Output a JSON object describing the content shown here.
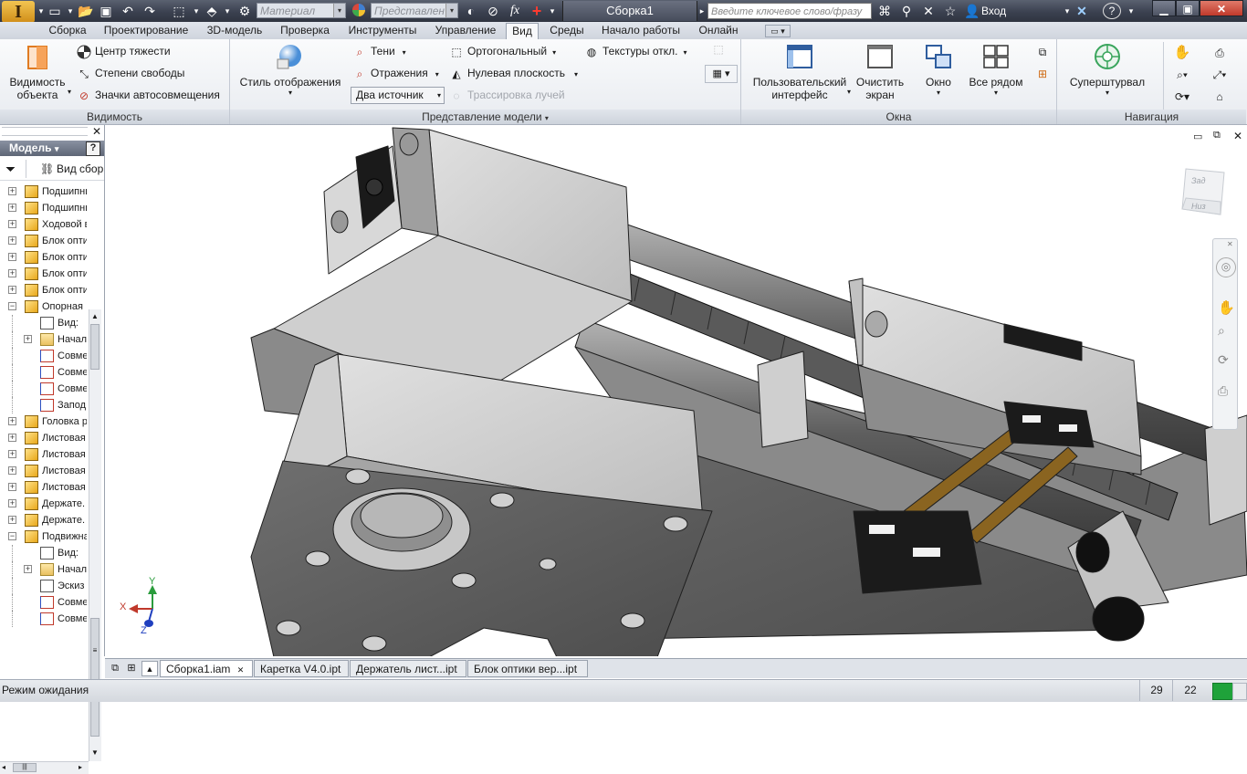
{
  "app": {
    "logo_letter": "I",
    "doc_title": "Сборка1",
    "material_placeholder": "Материал",
    "appearance_placeholder": "Представлен",
    "help_search_placeholder": "Введите ключевое слово/фразу",
    "login_label": "Вход",
    "help_label": "?",
    "qat_icons": [
      "new-icon",
      "open-icon",
      "save-icon",
      "undo-icon",
      "redo-icon",
      "return-icon",
      "select-icon",
      "update-icon"
    ]
  },
  "tabs": [
    {
      "label": "Сборка"
    },
    {
      "label": "Проектирование"
    },
    {
      "label": "3D-модель"
    },
    {
      "label": "Проверка"
    },
    {
      "label": "Инструменты"
    },
    {
      "label": "Управление"
    },
    {
      "label": "Вид",
      "active": true
    },
    {
      "label": "Среды"
    },
    {
      "label": "Начало работы"
    },
    {
      "label": "Онлайн"
    }
  ],
  "ribbon": {
    "visibility": {
      "label": "Видимость",
      "object_visibility": [
        "Видимость",
        "объекта"
      ],
      "items": [
        "Центр тяжести",
        "Степени свободы",
        "Значки автосовмещения"
      ]
    },
    "model_view": {
      "label": "Представление модели",
      "display_style": "Стиль отображения",
      "shadows": "Тени",
      "reflections": "Отражения",
      "lighting": "Два источник",
      "orthographic": "Ортогональный",
      "ground_plane": "Нулевая плоскость",
      "ray_tracing": "Трассировка лучей",
      "textures": "Текстуры откл."
    },
    "windows": {
      "label": "Окна",
      "user_interface": [
        "Пользовательский",
        "интерфейс"
      ],
      "clean_screen": [
        "Очистить",
        "экран"
      ],
      "window": "Окно",
      "tile": "Все рядом"
    },
    "navigation": {
      "label": "Навигация",
      "steering_wheel": "Суперштурвал"
    }
  },
  "browser": {
    "title": "Модель",
    "view_label": "Вид сбор",
    "tree": [
      {
        "label": "Подшипни",
        "icon": "box",
        "level": 0,
        "exp": "+"
      },
      {
        "label": "Подшипни",
        "icon": "box",
        "level": 0,
        "exp": "+"
      },
      {
        "label": "Ходовой в",
        "icon": "box",
        "level": 0,
        "exp": "+"
      },
      {
        "label": "Блок опти",
        "icon": "box",
        "level": 0,
        "exp": "+"
      },
      {
        "label": "Блок опти",
        "icon": "box",
        "level": 0,
        "exp": "+"
      },
      {
        "label": "Блок опти",
        "icon": "box",
        "level": 0,
        "exp": "+"
      },
      {
        "label": "Блок опти",
        "icon": "box",
        "level": 0,
        "exp": "+"
      },
      {
        "label": "Опорная",
        "icon": "box",
        "level": 0,
        "exp": "−"
      },
      {
        "label": "Вид:",
        "icon": "view",
        "level": 1,
        "exp": ""
      },
      {
        "label": "Начал",
        "icon": "folder",
        "level": 1,
        "exp": "+"
      },
      {
        "label": "Совме",
        "icon": "con",
        "level": 1,
        "exp": ""
      },
      {
        "label": "Совме",
        "icon": "con",
        "level": 1,
        "exp": ""
      },
      {
        "label": "Совме",
        "icon": "con",
        "level": 1,
        "exp": ""
      },
      {
        "label": "Запод",
        "icon": "con",
        "level": 1,
        "exp": ""
      },
      {
        "label": "Головка р",
        "icon": "box",
        "level": 0,
        "exp": "+"
      },
      {
        "label": "Листовая",
        "icon": "box",
        "level": 0,
        "exp": "+"
      },
      {
        "label": "Листовая",
        "icon": "box",
        "level": 0,
        "exp": "+"
      },
      {
        "label": "Листовая",
        "icon": "box",
        "level": 0,
        "exp": "+"
      },
      {
        "label": "Листовая",
        "icon": "box",
        "level": 0,
        "exp": "+"
      },
      {
        "label": "Держате.",
        "icon": "box",
        "level": 0,
        "exp": "+"
      },
      {
        "label": "Держате.",
        "icon": "box",
        "level": 0,
        "exp": "+"
      },
      {
        "label": "Подвижна",
        "icon": "box",
        "level": 0,
        "exp": "−"
      },
      {
        "label": "Вид:",
        "icon": "view",
        "level": 1,
        "exp": ""
      },
      {
        "label": "Начал",
        "icon": "folder",
        "level": 1,
        "exp": "+"
      },
      {
        "label": "Эскиз",
        "icon": "sketch",
        "level": 1,
        "exp": ""
      },
      {
        "label": "Совме",
        "icon": "con",
        "level": 1,
        "exp": ""
      },
      {
        "label": "Совме",
        "icon": "con",
        "level": 1,
        "exp": ""
      }
    ]
  },
  "viewcube": {
    "back": "Зад",
    "bottom": "Низ"
  },
  "triad": {
    "x": "X",
    "y": "Y",
    "z": "Z"
  },
  "doc_tabs": [
    {
      "label": "Сборка1.iam",
      "active": true
    },
    {
      "label": "Каретка V4.0.ipt"
    },
    {
      "label": "Держатель лист...ipt"
    },
    {
      "label": "Блок оптики вер...ipt"
    }
  ],
  "status": {
    "text": "Режим ожидания",
    "count1": "29",
    "count2": "22"
  }
}
